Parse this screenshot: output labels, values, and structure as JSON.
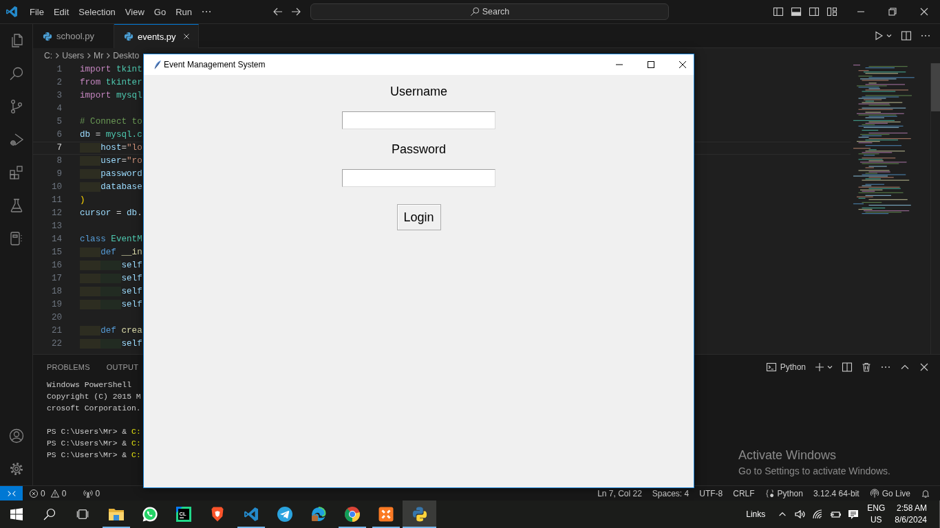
{
  "title_bar": {
    "menus": [
      "File",
      "Edit",
      "Selection",
      "View",
      "Go",
      "Run"
    ],
    "command_center": {
      "label": "Search"
    }
  },
  "editor_tabs": [
    {
      "label": "school.py",
      "selected": false
    },
    {
      "label": "events.py",
      "selected": true
    }
  ],
  "breadcrumb": [
    "C:",
    "Users",
    "Mr",
    "Deskto"
  ],
  "editor": {
    "lines": [
      {
        "number": "1",
        "current": false,
        "tokens": [
          {
            "kind": "control",
            "text": "import"
          },
          {
            "kind": "module",
            "text": " tkint"
          }
        ]
      },
      {
        "number": "2",
        "current": false,
        "tokens": [
          {
            "kind": "control",
            "text": "from"
          },
          {
            "kind": "module",
            "text": " tkinter"
          }
        ]
      },
      {
        "number": "3",
        "current": false,
        "tokens": [
          {
            "kind": "control",
            "text": "import"
          },
          {
            "kind": "module",
            "text": " mysql"
          }
        ]
      },
      {
        "number": "4",
        "current": false
      },
      {
        "number": "5",
        "current": false,
        "tokens": [
          {
            "kind": "comment",
            "text": "# Connect to"
          }
        ]
      },
      {
        "number": "6",
        "current": false,
        "tokens": [
          {
            "kind": "variable",
            "text": "db"
          },
          {
            "kind": "plain",
            "text": " = "
          },
          {
            "kind": "module",
            "text": "mysql.c"
          }
        ]
      },
      {
        "number": "7",
        "current": true,
        "tokens": [
          {
            "kind": "variable",
            "text": "    host"
          },
          {
            "kind": "plain",
            "text": "="
          },
          {
            "kind": "string",
            "text": "\"lo"
          }
        ]
      },
      {
        "number": "8",
        "current": false,
        "tokens": [
          {
            "kind": "variable",
            "text": "    user"
          },
          {
            "kind": "plain",
            "text": "="
          },
          {
            "kind": "string",
            "text": "\"ro"
          }
        ]
      },
      {
        "number": "9",
        "current": false,
        "tokens": [
          {
            "kind": "variable",
            "text": "    password"
          }
        ]
      },
      {
        "number": "10",
        "current": false,
        "tokens": [
          {
            "kind": "variable",
            "text": "    database"
          }
        ]
      },
      {
        "number": "11",
        "current": false,
        "tokens": [
          {
            "kind": "bracket",
            "text": ")"
          }
        ]
      },
      {
        "number": "12",
        "current": false,
        "tokens": [
          {
            "kind": "variable",
            "text": "cursor"
          },
          {
            "kind": "plain",
            "text": " = "
          },
          {
            "kind": "variable",
            "text": "db"
          },
          {
            "kind": "plain",
            "text": "."
          }
        ]
      },
      {
        "number": "13",
        "current": false
      },
      {
        "number": "14",
        "current": false,
        "tokens": [
          {
            "kind": "keyword",
            "text": "class"
          },
          {
            "kind": "class",
            "text": " EventM"
          }
        ]
      },
      {
        "number": "15",
        "current": false,
        "tokens": [
          {
            "kind": "keyword",
            "text": "    def"
          },
          {
            "kind": "function",
            "text": " __in"
          }
        ]
      },
      {
        "number": "16",
        "current": false,
        "tokens": [
          {
            "kind": "variable",
            "text": "        self"
          }
        ]
      },
      {
        "number": "17",
        "current": false,
        "tokens": [
          {
            "kind": "variable",
            "text": "        self"
          }
        ]
      },
      {
        "number": "18",
        "current": false,
        "tokens": [
          {
            "kind": "variable",
            "text": "        self"
          }
        ]
      },
      {
        "number": "19",
        "current": false,
        "tokens": [
          {
            "kind": "variable",
            "text": "        self"
          }
        ]
      },
      {
        "number": "20",
        "current": false
      },
      {
        "number": "21",
        "current": false,
        "tokens": [
          {
            "kind": "keyword",
            "text": "    def"
          },
          {
            "kind": "function",
            "text": " crea"
          }
        ]
      },
      {
        "number": "22",
        "current": false,
        "tokens": [
          {
            "kind": "variable",
            "text": "        self"
          }
        ]
      }
    ]
  },
  "panel": {
    "tabs": [
      {
        "label": "PROBLEMS",
        "selected": false
      },
      {
        "label": "OUTPUT",
        "selected": false
      }
    ],
    "terminal_name": "Python",
    "terminal_blocks": [
      [
        [
          {
            "kind": "plain",
            "text": "Windows PowerShell"
          }
        ],
        [
          {
            "kind": "plain",
            "text": "Copyright (C) 2015 M"
          }
        ],
        [
          {
            "kind": "plain",
            "text": "crosoft Corporation."
          }
        ]
      ],
      [
        [
          {
            "kind": "plain",
            "text": "PS C:\\Users\\Mr> & "
          },
          {
            "kind": "path",
            "text": "C:"
          }
        ],
        [
          {
            "kind": "plain",
            "text": "PS C:\\Users\\Mr> & "
          },
          {
            "kind": "path",
            "text": "C:"
          }
        ],
        [
          {
            "kind": "plain",
            "text": "PS C:\\Users\\Mr> & "
          },
          {
            "kind": "path",
            "text": "C:"
          }
        ]
      ]
    ]
  },
  "activation_notice": {
    "title": "Activate Windows",
    "text": "Go to Settings to activate Windows."
  },
  "status_bar": {
    "errors": "0",
    "warnings": "0",
    "ports": "0",
    "items": [
      {
        "kind": "text",
        "text": "Ln 7, Col 22"
      },
      {
        "kind": "text",
        "text": "Spaces: 4"
      },
      {
        "kind": "text",
        "text": "UTF-8"
      },
      {
        "kind": "text",
        "text": "CRLF"
      },
      {
        "kind": "language",
        "text": "Python"
      },
      {
        "kind": "text",
        "text": "3.12.4 64-bit"
      },
      {
        "kind": "live",
        "text": "Go Live"
      }
    ]
  },
  "taskbar": {
    "apps": [
      {
        "kind": "explorer",
        "running": true,
        "selected": false
      },
      {
        "kind": "whatsapp",
        "running": false,
        "selected": false
      },
      {
        "kind": "clion",
        "badge": "CL",
        "running": false,
        "selected": false
      },
      {
        "kind": "brave",
        "running": false,
        "selected": false
      },
      {
        "kind": "vscode",
        "running": true,
        "selected": false
      },
      {
        "kind": "telegram",
        "running": false,
        "selected": false
      },
      {
        "kind": "edge",
        "running": false,
        "selected": false
      },
      {
        "kind": "chrome",
        "running": true,
        "selected": false
      },
      {
        "kind": "xampp",
        "running": true,
        "selected": false
      },
      {
        "kind": "python",
        "running": true,
        "selected": true
      }
    ],
    "tray": {
      "links": "Links",
      "language": "ENG",
      "region": "US",
      "time": "2:58 AM",
      "date": "8/6/2024"
    }
  },
  "dialog": {
    "title": "Event Management System",
    "fields": [
      {
        "label": "Username"
      },
      {
        "label": "Password"
      }
    ],
    "button": "Login"
  }
}
